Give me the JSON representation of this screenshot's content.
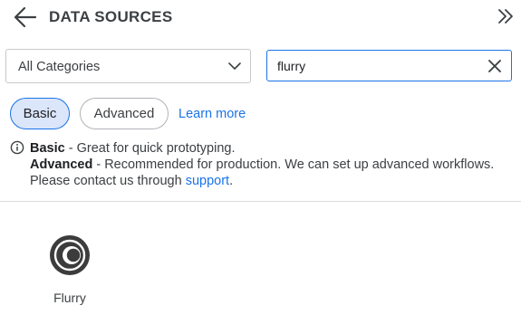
{
  "header": {
    "title": "DATA SOURCES",
    "back_icon": "arrow-left-icon",
    "collapse_icon": "chevrons-right-icon"
  },
  "filters": {
    "category_value": "All Categories",
    "category_icon": "chevron-down-icon",
    "search_value": "flurry",
    "clear_icon": "close-icon"
  },
  "modes": {
    "basic_label": "Basic",
    "advanced_label": "Advanced",
    "learn_more_label": "Learn more",
    "selected": "Basic"
  },
  "info": {
    "icon": "info-icon",
    "basic_term": "Basic",
    "basic_desc": " - Great for quick prototyping.",
    "advanced_term": "Advanced",
    "advanced_desc": " - Recommended for production. We can set up advanced workflows. Please contact us through ",
    "support_link": "support",
    "suffix": "."
  },
  "results": [
    {
      "name": "Flurry",
      "icon": "flurry-logo-icon"
    }
  ],
  "colors": {
    "accent": "#1a73e8",
    "chip_selected_bg": "#dbe6fb",
    "text": "#3c4043"
  }
}
